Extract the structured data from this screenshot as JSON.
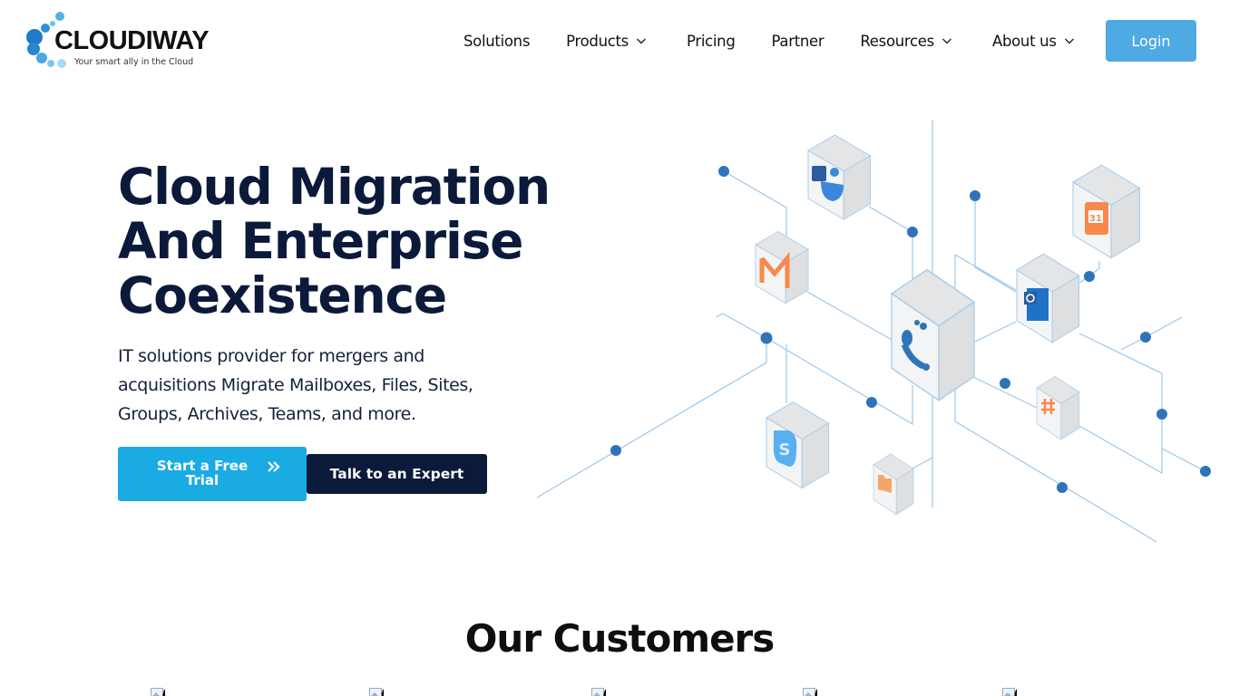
{
  "brand": {
    "name": "CLOUDIWAY",
    "tagline": "Your smart ally in the Cloud",
    "colors": {
      "primary_dark": "#0b1a3a",
      "accent_blue": "#1aabe3",
      "login_blue": "#4fa9e3",
      "node_blue": "#2f74b8",
      "line_blue": "#9cc8ea",
      "orange": "#f7894a"
    }
  },
  "nav": {
    "items": [
      {
        "label": "Solutions",
        "has_dropdown": false
      },
      {
        "label": "Products",
        "has_dropdown": true
      },
      {
        "label": "Pricing",
        "has_dropdown": false
      },
      {
        "label": "Partner",
        "has_dropdown": false
      },
      {
        "label": "Resources",
        "has_dropdown": true
      },
      {
        "label": "About us",
        "has_dropdown": true
      }
    ],
    "login_label": "Login"
  },
  "hero": {
    "title_lines": [
      "Cloud Migration",
      "And Enterprise",
      "Coexistence"
    ],
    "description": "IT solutions provider for mergers and acquisitions Migrate Mailboxes, Files, Sites, Groups, Archives, Teams, and more.",
    "cta_primary": "Start a Free Trial",
    "cta_primary_icon": "double-chevron-right-icon",
    "cta_secondary": "Talk to an Expert",
    "illustration_icons": [
      "microsoft-teams-icon",
      "gmail-icon",
      "google-calendar-icon",
      "outlook-icon",
      "cloudiway-icon",
      "slack-icon",
      "skype-icon",
      "folder-icon"
    ]
  },
  "customers": {
    "title": "Our Customers",
    "logos": [
      {
        "icon": "broken-image-icon"
      },
      {
        "icon": "broken-image-icon"
      },
      {
        "icon": "broken-image-icon"
      },
      {
        "icon": "broken-image-icon"
      },
      {
        "icon": "broken-image-icon"
      }
    ]
  }
}
